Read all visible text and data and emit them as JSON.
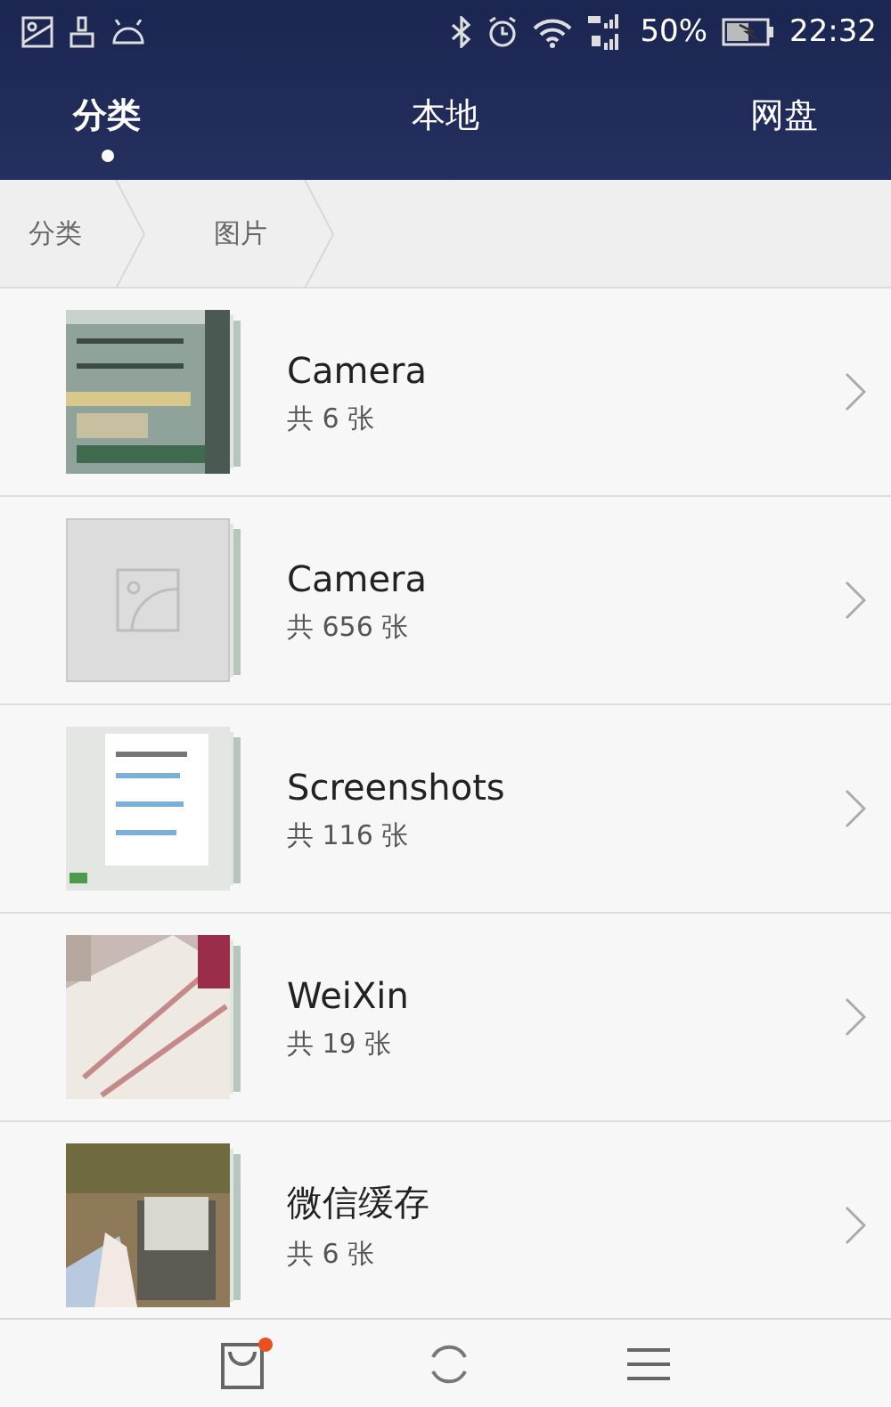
{
  "status_bar": {
    "battery": "50%",
    "time": "22:32"
  },
  "tabs": [
    {
      "label": "分类",
      "selected": true
    },
    {
      "label": "本地",
      "selected": false
    },
    {
      "label": "网盘",
      "selected": false
    }
  ],
  "breadcrumb": [
    "分类",
    "图片"
  ],
  "albums": [
    {
      "kind": "picture",
      "name": "Camera",
      "count": "共 6 张"
    },
    {
      "kind": "placeholder",
      "name": "Camera",
      "count": "共 656 张"
    },
    {
      "kind": "picture",
      "name": "Screenshots",
      "count": "共 116 张"
    },
    {
      "kind": "picture",
      "name": "WeiXin",
      "count": "共 19 张"
    },
    {
      "kind": "picture",
      "name": "微信缓存",
      "count": "共 6 张"
    }
  ],
  "bottom_bar": {
    "bag_badge": true
  }
}
